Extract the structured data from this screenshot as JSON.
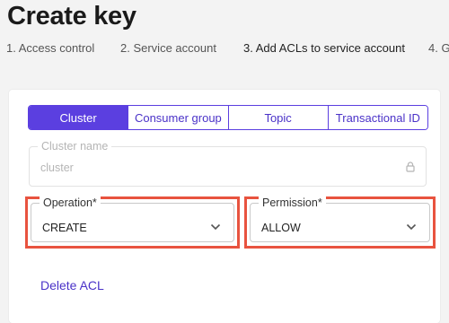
{
  "page": {
    "title": "Create key"
  },
  "steps": [
    "1. Access control",
    "2. Service account",
    "3. Add ACLs to service account",
    "4. G"
  ],
  "tabs": [
    {
      "label": "Cluster",
      "active": true
    },
    {
      "label": "Consumer group",
      "active": false
    },
    {
      "label": "Topic",
      "active": false
    },
    {
      "label": "Transactional ID",
      "active": false
    }
  ],
  "cluster_name": {
    "label": "Cluster name",
    "placeholder": "cluster",
    "locked": true,
    "icon": "lock-icon"
  },
  "operation": {
    "label": "Operation*",
    "value": "CREATE",
    "icon": "chevron-down-icon"
  },
  "permission": {
    "label": "Permission*",
    "value": "ALLOW",
    "icon": "chevron-down-icon"
  },
  "actions": {
    "delete_acl": "Delete ACL"
  },
  "colors": {
    "accent": "#5b3fe0",
    "highlight": "#e8533f"
  }
}
